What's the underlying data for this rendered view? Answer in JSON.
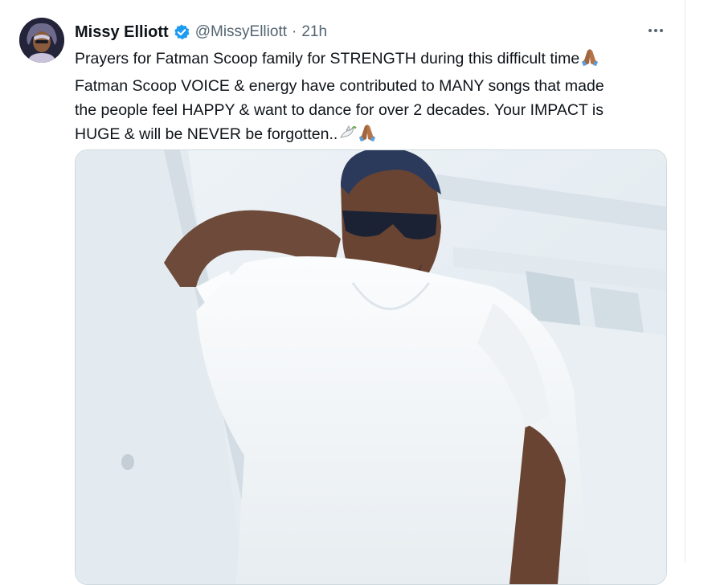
{
  "tweet": {
    "author_name": "Missy Elliott",
    "author_handle": "@MissyElliott",
    "separator": "·",
    "timestamp": "21h",
    "text_lines": [
      "Prayers for Fatman Scoop family for STRENGTH during this difficult time",
      "Fatman Scoop VOICE & energy have contributed to MANY songs that made",
      "the people feel HAPPY & want to dance for over 2 decades. Your IMPACT is",
      "HUGE & will be NEVER be forgotten.."
    ],
    "icons": {
      "verified": "verified-badge-icon",
      "more": "more-options-icon",
      "pray": "folded-hands-emoji",
      "dove": "dove-emoji"
    }
  },
  "colors": {
    "text": "#0f1419",
    "secondary": "#536471",
    "verified": "#1d9bf0",
    "border": "#cfd9de"
  }
}
